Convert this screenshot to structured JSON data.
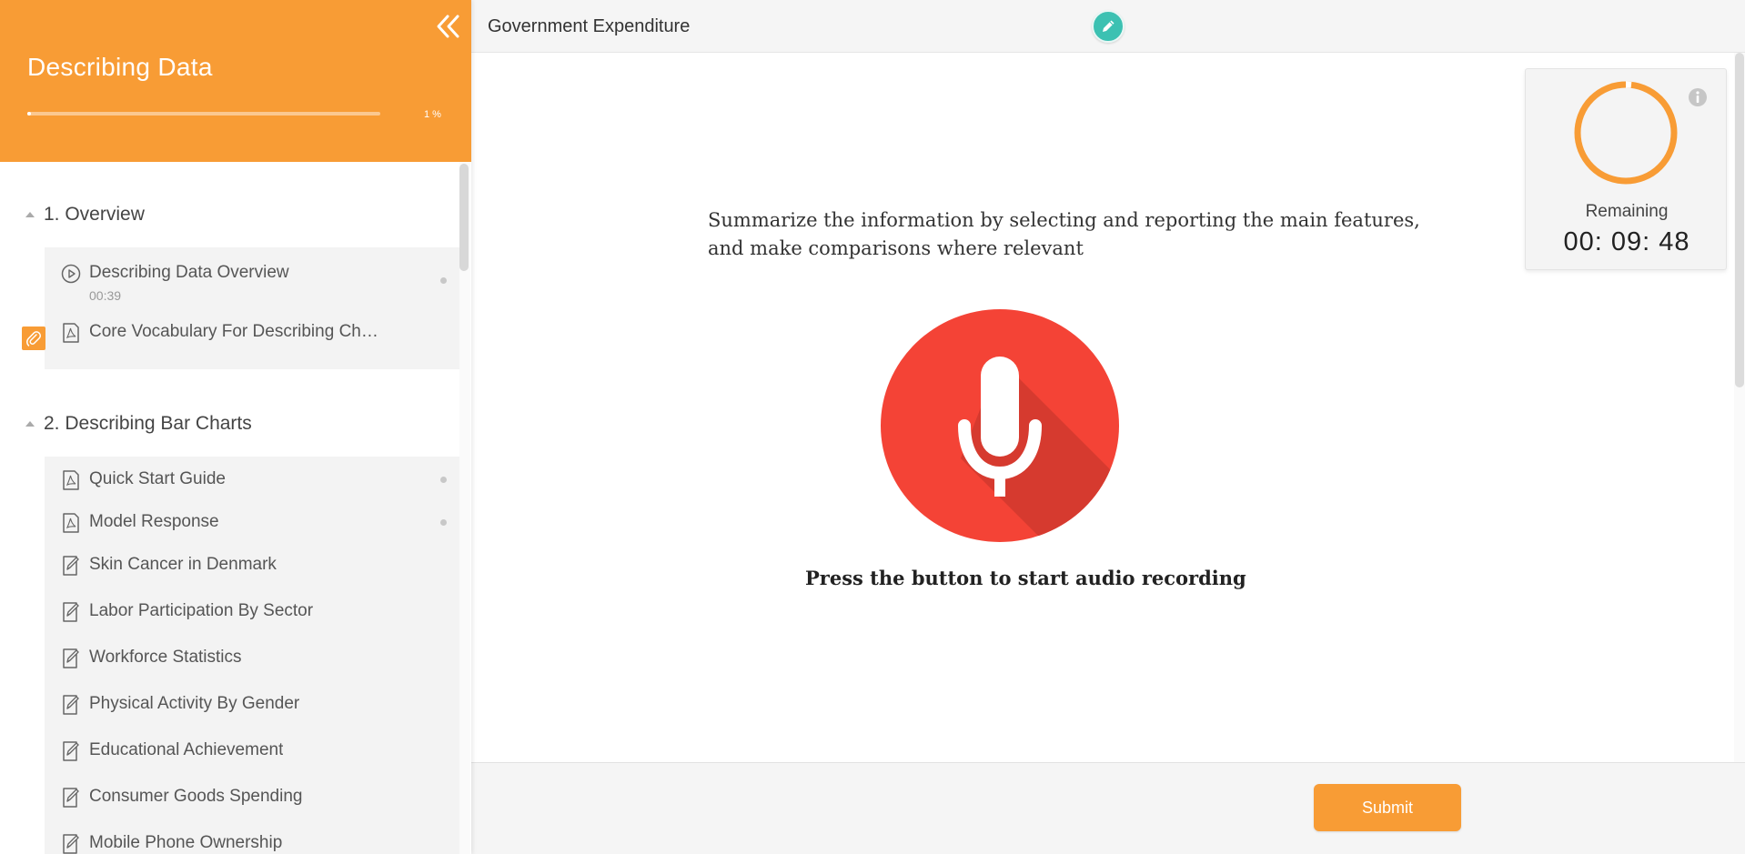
{
  "sidebar": {
    "course_title": "Describing Data",
    "progress_percent": 1,
    "progress_label": "1 %",
    "sections": [
      {
        "title": "1. Overview",
        "items": [
          {
            "label": "Describing Data Overview",
            "duration": "00:39",
            "icon": "play-circle-icon",
            "status": "dot"
          },
          {
            "label": "Core Vocabulary For Describing Ch…",
            "icon": "pdf-icon",
            "attachment": "paperclip-icon"
          }
        ]
      },
      {
        "title": "2. Describing Bar Charts",
        "items": [
          {
            "label": "Quick Start Guide",
            "icon": "pdf-icon",
            "status": "dot"
          },
          {
            "label": "Model Response",
            "icon": "pdf-icon",
            "status": "dot"
          },
          {
            "label": "Skin Cancer in Denmark",
            "icon": "edit-document-icon"
          },
          {
            "label": "Labor Participation By Sector",
            "icon": "edit-document-icon"
          },
          {
            "label": "Workforce Statistics",
            "icon": "edit-document-icon"
          },
          {
            "label": "Physical Activity By Gender",
            "icon": "edit-document-icon"
          },
          {
            "label": "Educational Achievement",
            "icon": "edit-document-icon"
          },
          {
            "label": "Consumer Goods Spending",
            "icon": "edit-document-icon"
          },
          {
            "label": "Mobile Phone Ownership",
            "icon": "edit-document-icon"
          }
        ]
      }
    ]
  },
  "header": {
    "lesson_title": "Government Expenditure",
    "edit_icon": "pencil-icon"
  },
  "main": {
    "prompt": "Summarize the information by selecting and reporting the main features, and make comparisons where relevant",
    "mic_icon": "microphone-icon",
    "record_caption": "Press the button to start audio recording"
  },
  "timer": {
    "label": "Remaining",
    "value": "00: 09: 48",
    "info_icon": "info-icon"
  },
  "footer": {
    "submit_label": "Submit"
  },
  "colors": {
    "accent": "#f89c35",
    "mic_red": "#f44336",
    "edit_teal": "#3cc1b2"
  }
}
